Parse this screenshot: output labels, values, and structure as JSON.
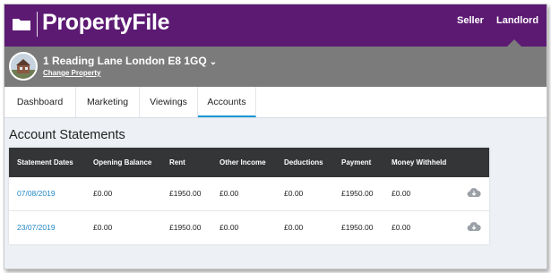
{
  "brand": {
    "name": "PropertyFile"
  },
  "nav": {
    "seller": "Seller",
    "landlord": "Landlord"
  },
  "property": {
    "address": "1 Reading Lane London E8 1GQ",
    "change_label": "Change Property"
  },
  "tabs": [
    {
      "label": "Dashboard"
    },
    {
      "label": "Marketing"
    },
    {
      "label": "Viewings"
    },
    {
      "label": "Accounts"
    }
  ],
  "active_tab": "Accounts",
  "section": {
    "title": "Account Statements"
  },
  "table": {
    "columns": [
      "Statement Dates",
      "Opening Balance",
      "Rent",
      "Other Income",
      "Deductions",
      "Payment",
      "Money Withheld"
    ],
    "rows": [
      {
        "date": "07/08/2019",
        "opening_balance": "£0.00",
        "rent": "£1950.00",
        "other_income": "£0.00",
        "deductions": "£0.00",
        "payment": "£1950.00",
        "money_withheld": "£0.00"
      },
      {
        "date": "23/07/2019",
        "opening_balance": "£0.00",
        "rent": "£1950.00",
        "other_income": "£0.00",
        "deductions": "£0.00",
        "payment": "£1950.00",
        "money_withheld": "£0.00"
      }
    ]
  },
  "icons": {
    "logo": "folder-icon",
    "download": "cloud-download-icon",
    "chevron": "chevron-down-icon"
  },
  "colors": {
    "brand_purple": "#5c1a73",
    "link_blue": "#2488c6",
    "tab_underline": "#1a98d5",
    "table_header": "#333537"
  }
}
